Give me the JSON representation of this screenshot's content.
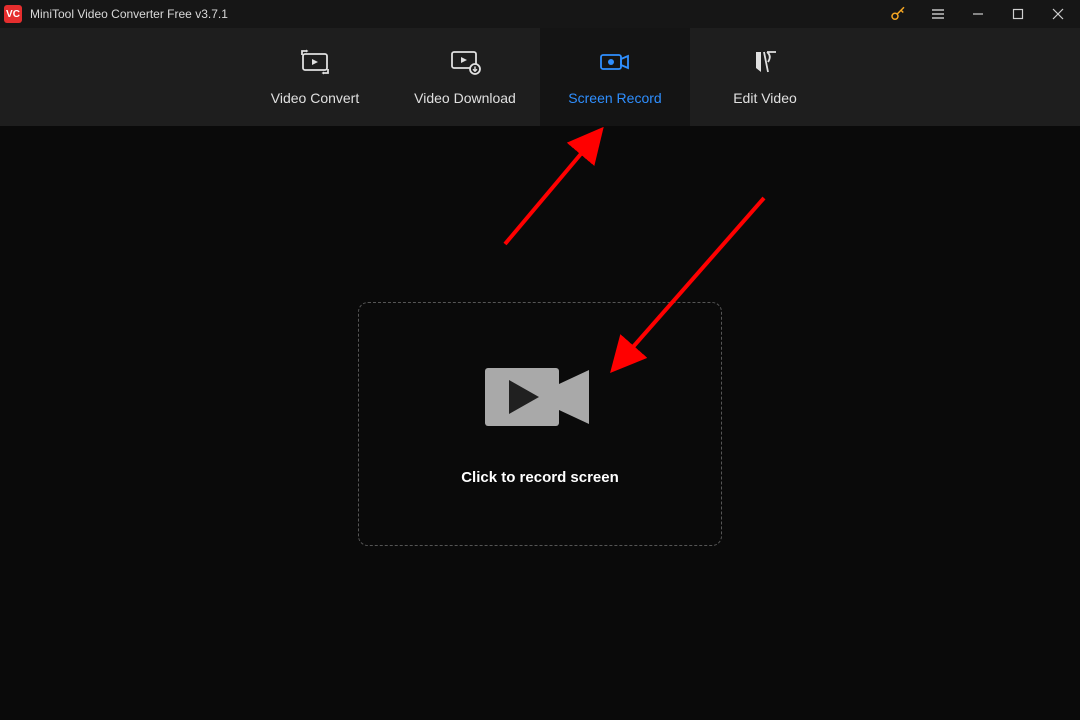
{
  "app": {
    "title": "MiniTool Video Converter Free v3.7.1",
    "icon_text": "VC"
  },
  "tabs": {
    "convert": {
      "label": "Video Convert"
    },
    "download": {
      "label": "Video Download"
    },
    "record": {
      "label": "Screen Record"
    },
    "edit": {
      "label": "Edit Video"
    }
  },
  "main": {
    "record_prompt": "Click to record screen"
  },
  "colors": {
    "accent": "#2f8fff",
    "arrow": "#ff0000"
  }
}
